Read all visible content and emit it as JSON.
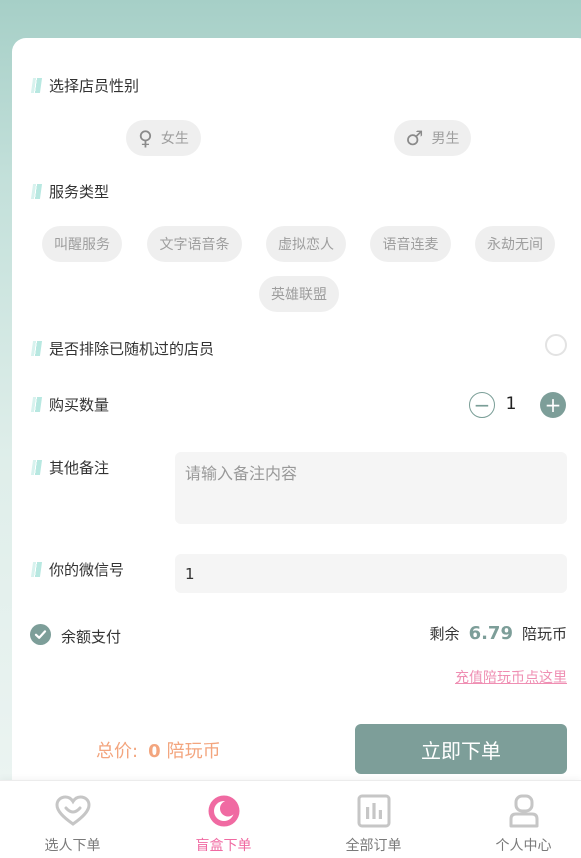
{
  "gender_section": {
    "label": "选择店员性别",
    "options": [
      {
        "label": "女生",
        "symbol": "♀",
        "icon": "female-icon"
      },
      {
        "label": "男生",
        "symbol": "♂",
        "icon": "male-icon"
      }
    ]
  },
  "service_section": {
    "label": "服务类型",
    "options": [
      "叫醒服务",
      "文字语音条",
      "虚拟恋人",
      "语音连麦",
      "永劫无间",
      "英雄联盟"
    ]
  },
  "exclude_section": {
    "label": "是否排除已随机过的店员",
    "checked": false
  },
  "quantity_section": {
    "label": "购买数量",
    "value": "1",
    "minus": "−",
    "plus": "+"
  },
  "remark_section": {
    "label": "其他备注",
    "placeholder": "请输入备注内容",
    "value": ""
  },
  "wechat_section": {
    "label": "你的微信号",
    "value": "1"
  },
  "payment": {
    "method_label": "余额支付",
    "selected": true,
    "remain_label": "剩余",
    "remain_value": "6.79",
    "unit": "陪玩币",
    "recharge_link": "充值陪玩币点这里"
  },
  "footer": {
    "total_label": "总价:",
    "total_value": "0",
    "total_unit": "陪玩币",
    "order_button": "立即下单"
  },
  "tabs": [
    {
      "label": "选人下单",
      "icon": "heart-face-icon",
      "active": false
    },
    {
      "label": "盲盒下单",
      "icon": "moon-icon",
      "active": true
    },
    {
      "label": "全部订单",
      "icon": "chart-bars-icon",
      "active": false
    },
    {
      "label": "个人中心",
      "icon": "user-icon",
      "active": false
    }
  ],
  "colors": {
    "accent": "#7d9e99",
    "pink": "#f06aa2",
    "price": "#f3a57e",
    "link": "#ef8fb3",
    "background_top": "#a6cfc7"
  }
}
